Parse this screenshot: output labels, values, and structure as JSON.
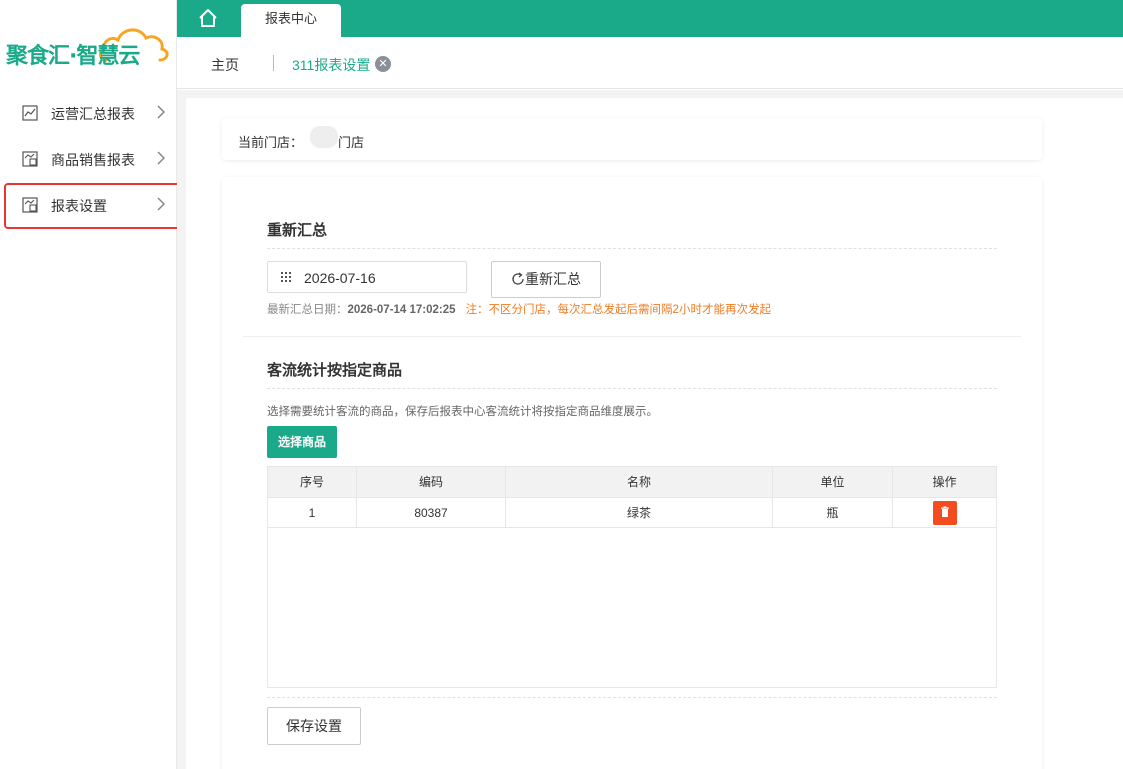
{
  "brand": {
    "logo_text": "聚食汇·智慧云",
    "accent_color": "#1aaa8a",
    "logo_cloud_color": "#f5a623"
  },
  "sidebar": {
    "items": [
      {
        "label": "运营汇总报表",
        "icon": "line-chart-icon"
      },
      {
        "label": "商品销售报表",
        "icon": "chart-doc-icon"
      },
      {
        "label": "报表设置",
        "icon": "chart-doc-icon",
        "highlighted": true
      }
    ]
  },
  "topbar": {
    "tab_label": "报表中心"
  },
  "tabs": {
    "home": "主页",
    "active": "311报表设置",
    "close_glyph": "✕"
  },
  "store": {
    "label": "当前门店：",
    "name": "门店"
  },
  "resummary": {
    "title": "重新汇总",
    "date_value": "2026-07-16",
    "button_label": "重新汇总",
    "latest_label": "最新汇总日期：",
    "latest_value": "2026-07-14 17:02:25",
    "warning": "注：不区分门店，每次汇总发起后需间隔2小时才能再次发起"
  },
  "traffic": {
    "title": "客流统计按指定商品",
    "description": "选择需要统计客流的商品，保存后报表中心客流统计将按指定商品维度展示。",
    "select_button": "选择商品",
    "columns": [
      "序号",
      "编码",
      "名称",
      "单位",
      "操作"
    ],
    "rows": [
      {
        "index": "1",
        "code": "80387",
        "name": "绿茶",
        "unit": "瓶"
      }
    ],
    "delete_color": "#f24c1f",
    "save_button": "保存设置"
  }
}
